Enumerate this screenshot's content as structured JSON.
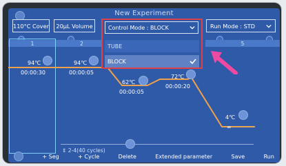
{
  "title": "New Experiment",
  "top_bar": {
    "cover_button": "110°C Cover",
    "volume_button": "20μL Volume",
    "control_mode": {
      "label": "Control Mode : BLOCK",
      "options": [
        "TUBE",
        "BLOCK"
      ],
      "selected": "BLOCK"
    },
    "run_mode": "Run Mode : STD"
  },
  "segments": [
    {
      "num": "1",
      "temp": "94℃",
      "time": "00:00:30"
    },
    {
      "num": "2",
      "temp": "94℃",
      "time": "00:00:05"
    },
    {
      "num": "",
      "temp": "62℃",
      "time": "00:00:05"
    },
    {
      "num": "",
      "temp": "72℃",
      "time": "00:00:20"
    },
    {
      "num": "5",
      "temp": "4℃",
      "time": "∞"
    }
  ],
  "cycle_info": "2-4(40 cycles)",
  "bottom_buttons": [
    "+ Seg",
    "+ Cycle",
    "Delete",
    "Extended parameter",
    "Save",
    "Run"
  ],
  "colors": {
    "screen_bg": "#2f5aa8",
    "orange": "#f0a14b",
    "selection": "#7fd1ff",
    "highlight_red": "#e04048",
    "arrow_pink": "#ef4aa2"
  },
  "icons": {
    "dropdown": "chevron-down-icon",
    "check": "check-icon",
    "home": "home-icon"
  }
}
